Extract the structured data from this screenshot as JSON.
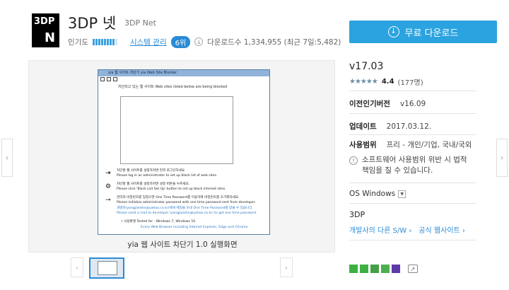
{
  "app": {
    "logo_line1": "3DP",
    "logo_line2": "N",
    "title": "3DP 넷",
    "subtitle": "3DP Net",
    "popularity_label": "인기도",
    "category": "시스템 관리",
    "rank": "6위",
    "downloads": "다운로드수 1,334,955 (최근 7일:5,482)"
  },
  "download_button": {
    "label": "무료 다운로드",
    "icon": "download-circle-icon"
  },
  "screenshot": {
    "window_title": "yia 웹 사이트 차단기  yia Web Site Blocker",
    "caption_blocked": "차단되고 있는 웹 사이트 Web sites listed below are being blocked",
    "line1a": "차단할 웹 사이트를 설정하려면 먼저 로그인하세요.",
    "line1b": "Please log in as administrator to set up black list of web sites.",
    "line2a": "차단할 웹 사이트를 설정하려면 설정 버튼을 누르세요.",
    "line2b": "Please click 'Black List Set Up' button to set up black internet sites.",
    "line3a": "관리자 비밀번호를 잊었으면 One Time Password를 이용하여 비밀번호를 초기화하세요.",
    "line3b": "Please initialize administrator password with one time password sent from developer.",
    "line4a": "개발자(yongjaeahn@yahoo.co.kr)에게 메일을 보내 One Time Password를 받을 수 있습니다.",
    "line4b": "Please send a mail to developer (yongjaeahn@yahoo.co.kr) to get one time password.",
    "line5": "• 사용환경 Tested for :   Windows 7, Windows 10",
    "line6": "Every Web Browser including Internet Explorer, Edge and Chrome",
    "caption": "yia 웹 사이트 차단기 1.0 실행화면"
  },
  "info": {
    "version": "v17.03",
    "stars_display": "★★★★★",
    "rating": "4.4",
    "rating_count": "(177명)",
    "prev_version_label": "이전인기버전",
    "prev_version_value": "v16.09",
    "update_label": "업데이트",
    "update_value": "2017.03.12.",
    "license_label": "사용범위",
    "license_value": "프리 - 개인/기업, 국내/국외",
    "warning": "소프트웨어 사용범위 위반 시 법적 책임을 질 수 있습니다.",
    "os_label": "OS Windows",
    "developer": "3DP",
    "other_sw_link": "개발사의 다른 S/W ›",
    "official_site_link": "공식 웹사이트 ›"
  },
  "colors": {
    "accent": "#2ba3e0",
    "link": "#2a8bd6"
  }
}
